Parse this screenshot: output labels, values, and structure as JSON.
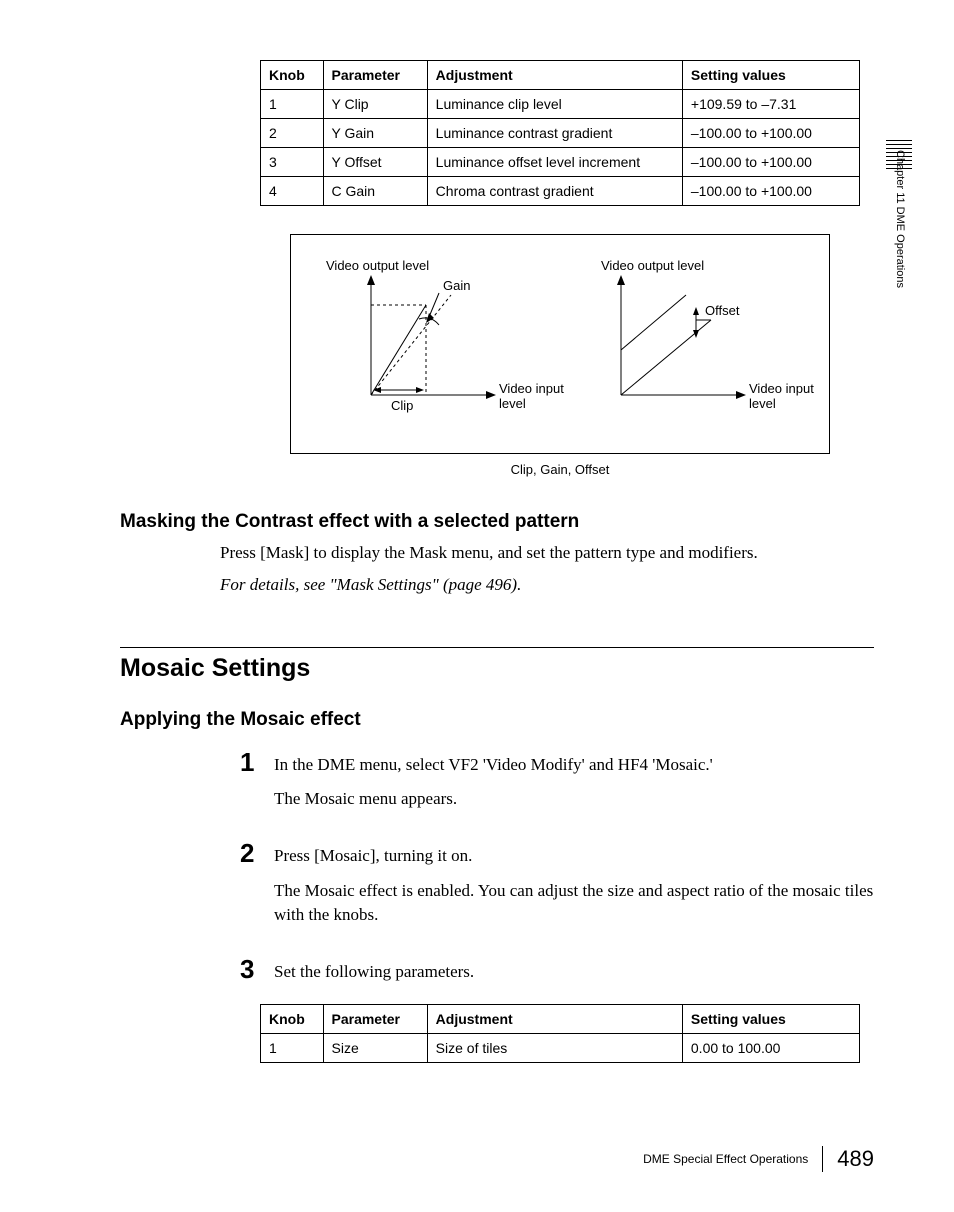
{
  "sidebar_label": "Chapter 11  DME Operations",
  "table1": {
    "headers": [
      "Knob",
      "Parameter",
      "Adjustment",
      "Setting values"
    ],
    "rows": [
      [
        "1",
        "Y Clip",
        "Luminance clip level",
        "+109.59 to –7.31"
      ],
      [
        "2",
        "Y Gain",
        "Luminance contrast gradient",
        "–100.00 to +100.00"
      ],
      [
        "3",
        "Y Offset",
        "Luminance offset level increment",
        "–100.00 to +100.00"
      ],
      [
        "4",
        "C Gain",
        "Chroma contrast gradient",
        "–100.00 to +100.00"
      ]
    ]
  },
  "diagram": {
    "left_ylabel": "Video output level",
    "left_gain": "Gain",
    "left_clip": "Clip",
    "left_xlabel1": "Video input",
    "left_xlabel2": "level",
    "right_ylabel": "Video output level",
    "right_offset": "Offset",
    "right_xlabel1": "Video input",
    "right_xlabel2": "level",
    "caption": "Clip, Gain, Offset"
  },
  "section_mask": {
    "heading": "Masking the Contrast effect with a selected pattern",
    "p1": "Press [Mask] to display the Mask menu, and set the pattern type and modifiers.",
    "p2": "For details, see \"Mask Settings\" (page 496)."
  },
  "section_mosaic": {
    "title": "Mosaic Settings",
    "heading": "Applying the Mosaic effect",
    "steps": {
      "s1n": "1",
      "s1a": "In the DME menu, select VF2 'Video Modify' and HF4 'Mosaic.'",
      "s1b": "The Mosaic menu appears.",
      "s2n": "2",
      "s2a": "Press [Mosaic], turning it on.",
      "s2b": "The Mosaic effect is enabled. You can adjust the size and aspect ratio of the mosaic tiles with the knobs.",
      "s3n": "3",
      "s3a": "Set the following parameters."
    }
  },
  "table2": {
    "headers": [
      "Knob",
      "Parameter",
      "Adjustment",
      "Setting values"
    ],
    "rows": [
      [
        "1",
        "Size",
        "Size of tiles",
        "0.00 to 100.00"
      ]
    ]
  },
  "footer": {
    "section": "DME Special Effect Operations",
    "page": "489"
  }
}
